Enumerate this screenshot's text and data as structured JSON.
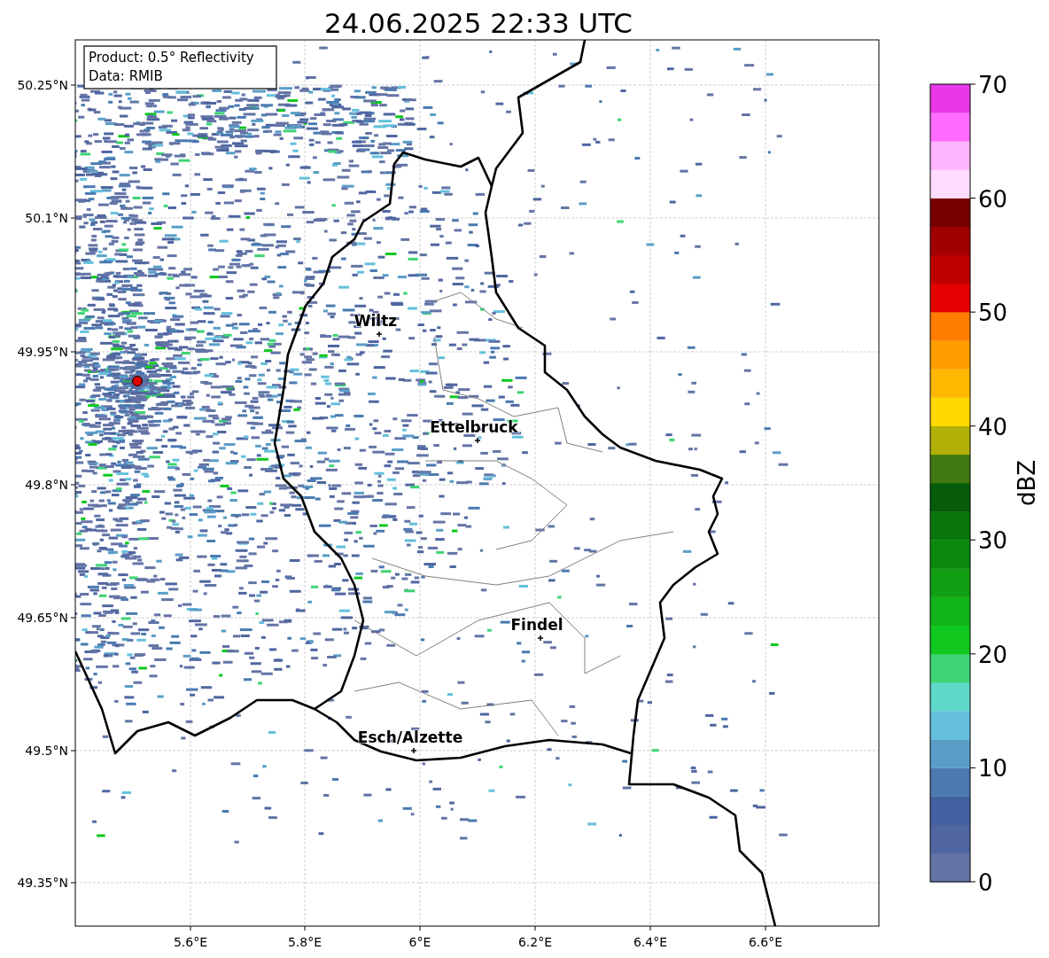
{
  "title": "24.06.2025 22:33 UTC",
  "info_box": {
    "lines": [
      "Product: 0.5° Reflectivity",
      "Data: RMIB"
    ]
  },
  "y_ticks": [
    "50.25°N",
    "50.1°N",
    "49.95°N",
    "49.8°N",
    "49.65°N",
    "49.5°N",
    "49.35°N"
  ],
  "x_ticks": [
    "5.6°E",
    "5.8°E",
    "6°E",
    "6.2°E",
    "6.4°E",
    "6.6°E"
  ],
  "cities": [
    {
      "name": "Wiltz"
    },
    {
      "name": "Ettelbruck"
    },
    {
      "name": "Findel"
    },
    {
      "name": "Esch/Alzette"
    }
  ],
  "colorbar": {
    "label": "dBZ",
    "ticks": [
      "70",
      "60",
      "50",
      "40",
      "30",
      "20",
      "10",
      "0"
    ],
    "bands": [
      {
        "color": "#6474a6"
      },
      {
        "color": "#4f66a0"
      },
      {
        "color": "#4360a0"
      },
      {
        "color": "#4a7ab0"
      },
      {
        "color": "#5a9ec8"
      },
      {
        "color": "#64c0dc"
      },
      {
        "color": "#5ed8c8"
      },
      {
        "color": "#3ed474"
      },
      {
        "color": "#10c81e"
      },
      {
        "color": "#10b418"
      },
      {
        "color": "#109e14"
      },
      {
        "color": "#0c8a10"
      },
      {
        "color": "#08760c"
      },
      {
        "color": "#065c08"
      },
      {
        "color": "#427810"
      },
      {
        "color": "#b0b008"
      },
      {
        "color": "#ffd800"
      },
      {
        "color": "#ffb800"
      },
      {
        "color": "#ff9c00"
      },
      {
        "color": "#ff7c00"
      },
      {
        "color": "#e40000"
      },
      {
        "color": "#c00000"
      },
      {
        "color": "#a00000"
      },
      {
        "color": "#780000"
      },
      {
        "color": "#ffdcff"
      },
      {
        "color": "#ffb4ff"
      },
      {
        "color": "#ff6cff"
      },
      {
        "color": "#e838e8"
      }
    ]
  }
}
